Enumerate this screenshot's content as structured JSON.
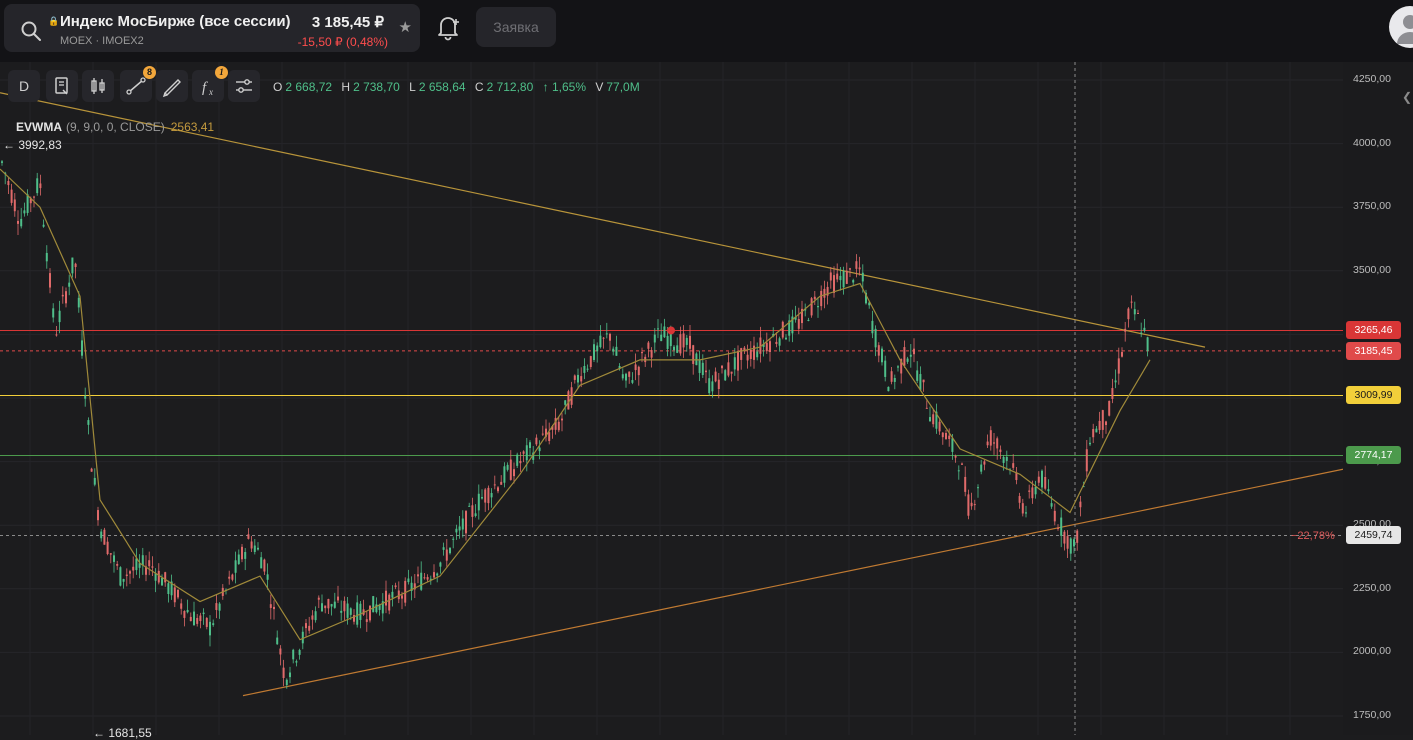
{
  "header": {
    "ticker_name": "Индекс МосБирже (все сессии)",
    "exchange": "MOEX",
    "ticker_code": "IMOEX2",
    "exchange_line": "MOEX · IMOEX2",
    "price": "3 185,45 ₽",
    "change": "-15,50 ₽ (0,48%)",
    "order_button": "Заявка",
    "change_color": "#ff4d4d"
  },
  "toolbar": {
    "interval": "D",
    "drawings_badge": "8",
    "indicators_badge": "1",
    "icons": [
      "interval-button",
      "script-icon",
      "candles-icon",
      "drawings-icon",
      "brush-icon",
      "indicators-icon",
      "settings-icon"
    ]
  },
  "ohlc": {
    "o_label": "O",
    "o": "2 668,72",
    "h_label": "H",
    "h": "2 738,70",
    "l_label": "L",
    "l": "2 658,64",
    "c_label": "C",
    "c": "2 712,80",
    "change": "↑ 1,65%",
    "v_label": "V",
    "v": "77,0M"
  },
  "indicator": {
    "name": "EVWMA",
    "params": "(9, 9,0, 0, CLOSE)",
    "value": "2563,41"
  },
  "annotations": {
    "high": "← 3992,83",
    "low": "← 1681,55",
    "pct": "−22,78%"
  },
  "yaxis": {
    "ticks": [
      "4250,00",
      "4000,00",
      "3750,00",
      "3500,00",
      "3250,00",
      "3000,00",
      "2750,00",
      "2500,00",
      "2250,00",
      "2000,00",
      "1750,00"
    ],
    "tick_values": [
      4250,
      4000,
      3750,
      3500,
      3250,
      3000,
      2750,
      2500,
      2250,
      2000,
      1750
    ],
    "badges": [
      {
        "label": "3265,46",
        "value": 3265.46,
        "bg": "#d93636",
        "fg": "#ffffff"
      },
      {
        "label": "3185,45",
        "value": 3185.45,
        "bg": "#e04a4a",
        "fg": "#ffffff"
      },
      {
        "label": "3009,99",
        "value": 3009.99,
        "bg": "#f2cf3a",
        "fg": "#1a1a1a"
      },
      {
        "label": "2774,17",
        "value": 2774.17,
        "bg": "#4c9a4c",
        "fg": "#ffffff"
      },
      {
        "label": "2459,74",
        "value": 2459.74,
        "bg": "#e6e6e6",
        "fg": "#1a1a1a"
      }
    ]
  },
  "chart_data": {
    "type": "line",
    "title": "",
    "ylim": [
      1681.55,
      4300
    ],
    "grid": true,
    "price_path": [
      {
        "x": 0,
        "y": 3950
      },
      {
        "x": 20,
        "y": 3700
      },
      {
        "x": 40,
        "y": 3850
      },
      {
        "x": 55,
        "y": 3250
      },
      {
        "x": 75,
        "y": 3550
      },
      {
        "x": 90,
        "y": 2800
      },
      {
        "x": 100,
        "y": 2500
      },
      {
        "x": 120,
        "y": 2300
      },
      {
        "x": 150,
        "y": 2350
      },
      {
        "x": 190,
        "y": 2150
      },
      {
        "x": 210,
        "y": 2100
      },
      {
        "x": 250,
        "y": 2450
      },
      {
        "x": 265,
        "y": 2350
      },
      {
        "x": 285,
        "y": 1900
      },
      {
        "x": 320,
        "y": 2200
      },
      {
        "x": 360,
        "y": 2150
      },
      {
        "x": 410,
        "y": 2250
      },
      {
        "x": 440,
        "y": 2350
      },
      {
        "x": 480,
        "y": 2600
      },
      {
        "x": 520,
        "y": 2750
      },
      {
        "x": 560,
        "y": 2900
      },
      {
        "x": 580,
        "y": 3100
      },
      {
        "x": 610,
        "y": 3250
      },
      {
        "x": 625,
        "y": 3050
      },
      {
        "x": 660,
        "y": 3250
      },
      {
        "x": 690,
        "y": 3200
      },
      {
        "x": 710,
        "y": 3050
      },
      {
        "x": 740,
        "y": 3150
      },
      {
        "x": 780,
        "y": 3250
      },
      {
        "x": 800,
        "y": 3300
      },
      {
        "x": 830,
        "y": 3450
      },
      {
        "x": 860,
        "y": 3500
      },
      {
        "x": 875,
        "y": 3250
      },
      {
        "x": 890,
        "y": 3050
      },
      {
        "x": 910,
        "y": 3200
      },
      {
        "x": 930,
        "y": 2950
      },
      {
        "x": 960,
        "y": 2750
      },
      {
        "x": 970,
        "y": 2550
      },
      {
        "x": 990,
        "y": 2850
      },
      {
        "x": 1010,
        "y": 2750
      },
      {
        "x": 1025,
        "y": 2550
      },
      {
        "x": 1040,
        "y": 2700
      },
      {
        "x": 1060,
        "y": 2500
      },
      {
        "x": 1075,
        "y": 2400
      },
      {
        "x": 1090,
        "y": 2850
      },
      {
        "x": 1110,
        "y": 2950
      },
      {
        "x": 1130,
        "y": 3350
      },
      {
        "x": 1140,
        "y": 3300
      },
      {
        "x": 1150,
        "y": 3185.45
      }
    ],
    "evwma_path": [
      {
        "x": 0,
        "y": 3900
      },
      {
        "x": 40,
        "y": 3750
      },
      {
        "x": 80,
        "y": 3400
      },
      {
        "x": 100,
        "y": 2600
      },
      {
        "x": 140,
        "y": 2350
      },
      {
        "x": 200,
        "y": 2200
      },
      {
        "x": 260,
        "y": 2300
      },
      {
        "x": 300,
        "y": 2050
      },
      {
        "x": 360,
        "y": 2150
      },
      {
        "x": 440,
        "y": 2300
      },
      {
        "x": 520,
        "y": 2700
      },
      {
        "x": 580,
        "y": 3050
      },
      {
        "x": 640,
        "y": 3150
      },
      {
        "x": 700,
        "y": 3150
      },
      {
        "x": 760,
        "y": 3200
      },
      {
        "x": 820,
        "y": 3400
      },
      {
        "x": 860,
        "y": 3450
      },
      {
        "x": 900,
        "y": 3150
      },
      {
        "x": 960,
        "y": 2800
      },
      {
        "x": 1020,
        "y": 2700
      },
      {
        "x": 1070,
        "y": 2550
      },
      {
        "x": 1120,
        "y": 2950
      },
      {
        "x": 1150,
        "y": 3150
      }
    ],
    "horizontal_levels": [
      {
        "value": 3265.46,
        "color": "#d93636"
      },
      {
        "value": 3185.45,
        "color": "#e04a4a",
        "dashed": true
      },
      {
        "value": 3009.99,
        "color": "#f2cf3a"
      },
      {
        "value": 2774.17,
        "color": "#4c9a4c"
      },
      {
        "value": 2459.74,
        "color": "#8a8a8a",
        "dashed": true
      }
    ],
    "trend_lines": [
      {
        "from": {
          "x": 0,
          "y": 4200
        },
        "to": {
          "x": 1205,
          "y": 3200
        },
        "color": "#b8943a"
      },
      {
        "from": {
          "x": 243,
          "y": 1830
        },
        "to": {
          "x": 1343,
          "y": 2720
        },
        "color": "#c07a32"
      }
    ],
    "crosshair_x": 1075
  }
}
